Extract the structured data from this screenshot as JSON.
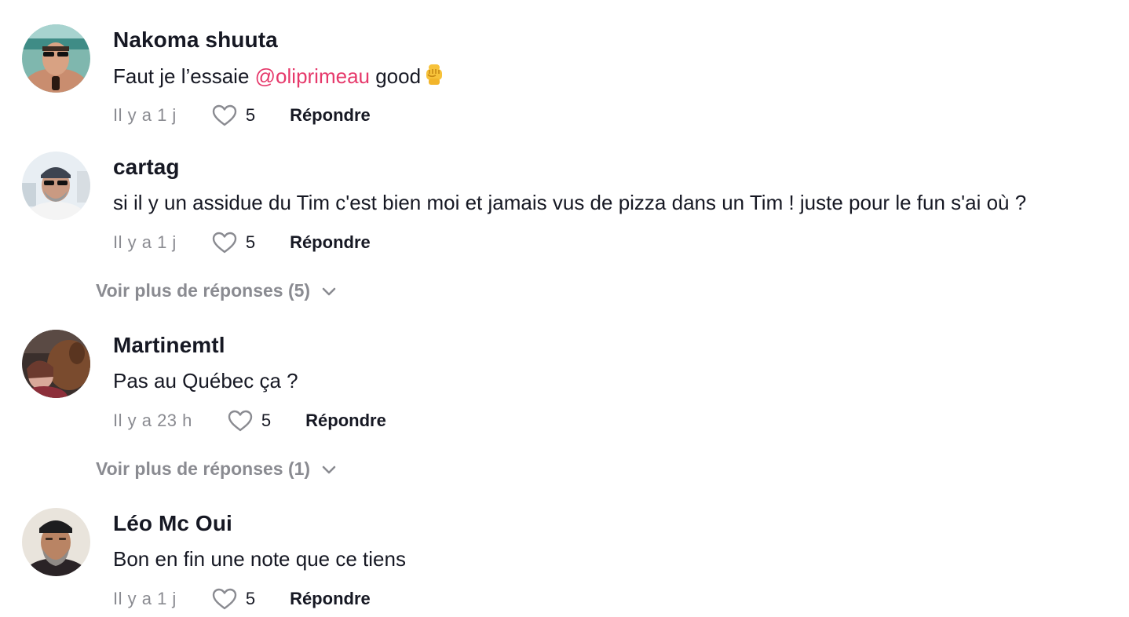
{
  "comments": [
    {
      "username": "Nakoma shuuta",
      "text_before": "Faut je l’essaie ",
      "mention": "@oliprimeau",
      "text_after": " good",
      "emoji": "raised-fist-emoji",
      "time": "Il y a 1 j",
      "likes": "5",
      "reply_label": "Répondre"
    },
    {
      "username": "cartag",
      "text": "si il y un assidue du Tim c'est bien moi et jamais vus de pizza dans un Tim ! juste pour le fun s'ai où ?",
      "time": "Il y a 1 j",
      "likes": "5",
      "reply_label": "Répondre",
      "more_replies": "Voir plus de réponses (5)"
    },
    {
      "username": "Martinemtl",
      "text": "Pas au Québec ça ?",
      "time": "Il y a 23 h",
      "likes": "5",
      "reply_label": "Répondre",
      "more_replies": "Voir plus de réponses (1)"
    },
    {
      "username": "Léo Mc Oui",
      "text": "Bon en fin une note que ce tiens",
      "time": "Il y a 1 j",
      "likes": "5",
      "reply_label": "Répondre"
    }
  ],
  "colors": {
    "text": "#161823",
    "muted": "#8a8b91",
    "mention": "#e6396b"
  },
  "icons": {
    "like": "heart-outline-icon",
    "expand": "chevron-down-icon"
  }
}
